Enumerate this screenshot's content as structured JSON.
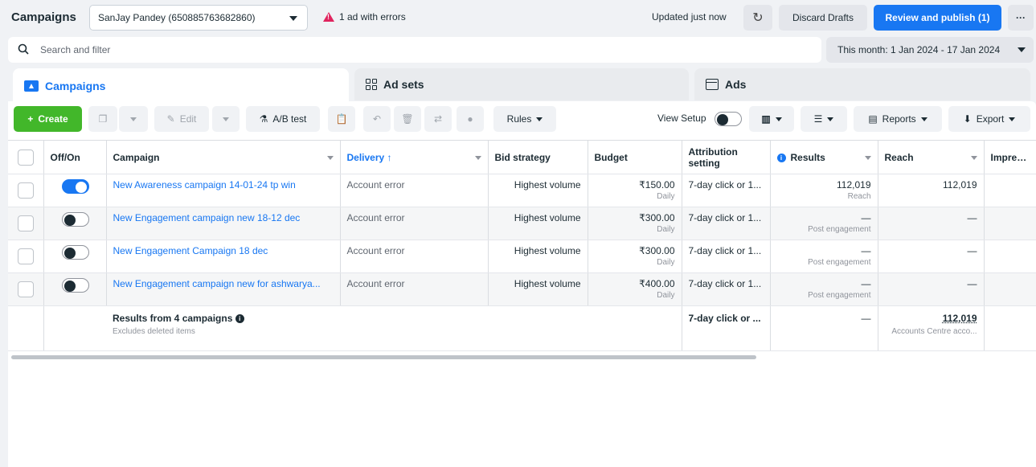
{
  "header": {
    "title": "Campaigns",
    "account": "SanJay Pandey (650885763682860)",
    "error_text": "1 ad with errors",
    "updated": "Updated just now",
    "discard": "Discard Drafts",
    "publish": "Review and publish (1)",
    "more": "···"
  },
  "search": {
    "placeholder": "Search and filter"
  },
  "date_range": "This month: 1 Jan 2024 - 17 Jan 2024",
  "tabs": [
    {
      "label": "Campaigns",
      "active": true
    },
    {
      "label": "Ad sets",
      "active": false
    },
    {
      "label": "Ads",
      "active": false
    }
  ],
  "toolbar": {
    "create": "Create",
    "edit": "Edit",
    "ab_test": "A/B test",
    "rules": "Rules",
    "view_setup": "View Setup",
    "reports": "Reports",
    "export": "Export"
  },
  "columns": {
    "off_on": "Off/On",
    "campaign": "Campaign",
    "delivery": "Delivery ↑",
    "bid_strategy": "Bid strategy",
    "budget": "Budget",
    "attribution": "Attribution setting",
    "results": "Results",
    "reach": "Reach",
    "impressions": "Impressi"
  },
  "rows": [
    {
      "on": true,
      "campaign": "New Awareness campaign 14-01-24 tp win",
      "delivery": "Account error",
      "bid": "Highest volume",
      "budget": "₹150.00",
      "budget_period": "Daily",
      "attribution": "7-day click or 1...",
      "results": "112,019",
      "results_sub": "Reach",
      "reach": "112,019"
    },
    {
      "on": false,
      "campaign": "New Engagement campaign new 18-12 dec",
      "delivery": "Account error",
      "bid": "Highest volume",
      "budget": "₹300.00",
      "budget_period": "Daily",
      "attribution": "7-day click or 1...",
      "results": "—",
      "results_sub": "Post engagement",
      "reach": "—"
    },
    {
      "on": false,
      "campaign": "New Engagement Campaign 18 dec",
      "delivery": "Account error",
      "bid": "Highest volume",
      "budget": "₹300.00",
      "budget_period": "Daily",
      "attribution": "7-day click or 1...",
      "results": "—",
      "results_sub": "Post engagement",
      "reach": "—"
    },
    {
      "on": false,
      "campaign": "New Engagement campaign new for ashwarya...",
      "delivery": "Account error",
      "bid": "Highest volume",
      "budget": "₹400.00",
      "budget_period": "Daily",
      "attribution": "7-day click or 1...",
      "results": "—",
      "results_sub": "Post engagement",
      "reach": "—"
    }
  ],
  "total": {
    "label": "Results from 4 campaigns",
    "sub": "Excludes deleted items",
    "attribution": "7-day click or ...",
    "results": "—",
    "reach": "112,019",
    "reach_sub": "Accounts Centre acco..."
  },
  "colors": {
    "accent": "#1877f2",
    "create": "#42b72a",
    "error": "#e0245e"
  }
}
